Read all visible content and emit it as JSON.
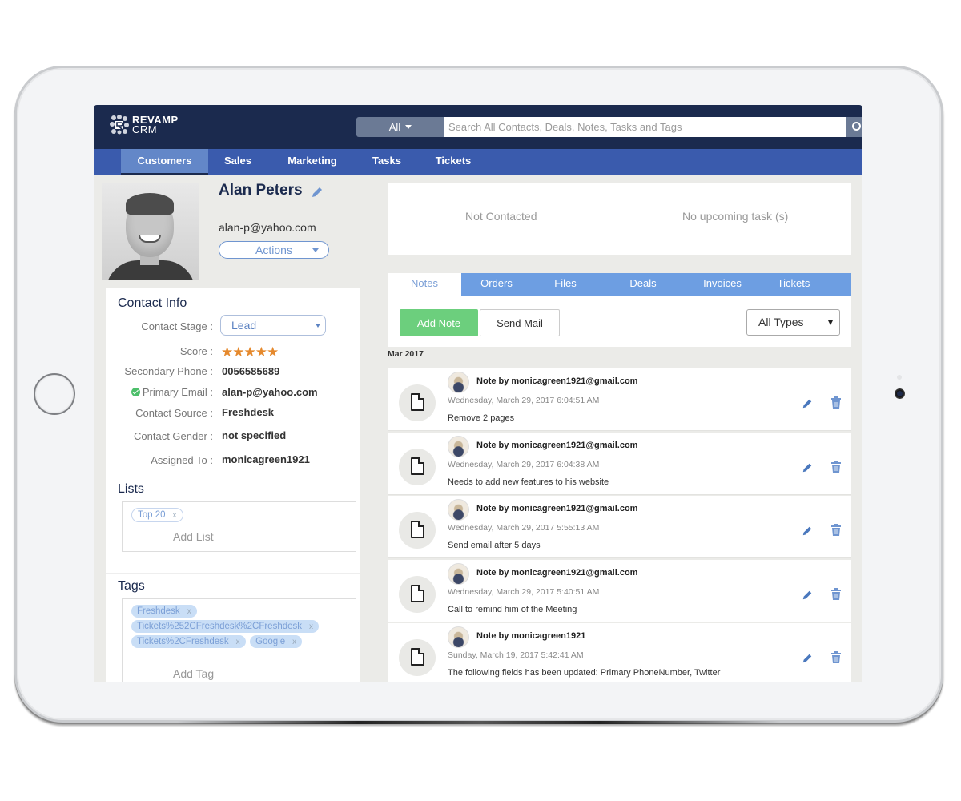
{
  "app": {
    "brand_line1": "REVAMP",
    "brand_line2": "CRM"
  },
  "search": {
    "scope": "All",
    "placeholder": "Search All Contacts, Deals, Notes, Tasks and Tags"
  },
  "nav": {
    "items": [
      {
        "label": "Customers",
        "active": true
      },
      {
        "label": "Sales"
      },
      {
        "label": "Marketing"
      },
      {
        "label": "Tasks"
      },
      {
        "label": "Tickets"
      }
    ]
  },
  "contact": {
    "name": "Alan Peters",
    "email": "alan-p@yahoo.com",
    "actions_label": "Actions"
  },
  "contact_info": {
    "title": "Contact Info",
    "stage_label": "Contact Stage :",
    "stage_value": "Lead",
    "score_label": "Score :",
    "score_stars": 5,
    "score_max": 5,
    "fields": [
      {
        "label": "Secondary Phone :",
        "value": "0056585689"
      },
      {
        "label": "Primary Email :",
        "value": "alan-p@yahoo.com",
        "verified": true
      },
      {
        "label": "Contact Source :",
        "value": "Freshdesk"
      },
      {
        "label": "Contact Gender :",
        "value": "not specified"
      },
      {
        "label": "Assigned To :",
        "value": "monicagreen1921"
      }
    ]
  },
  "lists": {
    "title": "Lists",
    "items": [
      "Top 20"
    ],
    "add_label": "Add List"
  },
  "tags": {
    "title": "Tags",
    "items": [
      "Freshdesk",
      "Tickets%252CFreshdesk%2CFreshdesk",
      "Tickets%2CFreshdesk",
      "Google"
    ],
    "add_label": "Add Tag"
  },
  "status": {
    "contact_status": "Not Contacted",
    "tasks_status": "No upcoming task (s)"
  },
  "tabs": {
    "items": [
      {
        "label": "Notes",
        "active": true
      },
      {
        "label": "Orders"
      },
      {
        "label": "Files"
      },
      {
        "label": "Deals"
      },
      {
        "label": "Invoices"
      },
      {
        "label": "Tickets"
      }
    ]
  },
  "toolbar": {
    "add_note_label": "Add Note",
    "send_mail_label": "Send Mail",
    "type_filter": "All Types"
  },
  "notes": {
    "month": "Mar 2017",
    "items": [
      {
        "author": "Note by monicagreen1921@gmail.com",
        "date": "Wednesday, March 29, 2017 6:04:51 AM",
        "text": "Remove 2 pages"
      },
      {
        "author": "Note by monicagreen1921@gmail.com",
        "date": "Wednesday, March 29, 2017 6:04:38 AM",
        "text": "Needs to add new features to his website"
      },
      {
        "author": "Note by monicagreen1921@gmail.com",
        "date": "Wednesday, March 29, 2017 5:55:13 AM",
        "text": "Send email after 5 days"
      },
      {
        "author": "Note by monicagreen1921@gmail.com",
        "date": "Wednesday, March 29, 2017 5:40:51 AM",
        "text": "Call to remind him of the Meeting"
      },
      {
        "author": "Note by monicagreen1921",
        "date": "Sunday, March 19, 2017 5:42:41 AM",
        "text": "The following fields has been updated: Primary PhoneNumber, Twitter Account, Secondary PhoneNumber, Contact Source, Tags, Groups, Score"
      }
    ]
  },
  "colors": {
    "topbar": "#1b2a4e",
    "navbar": "#3a5bad",
    "nav_active": "#6387c8",
    "tabs": "#6d9ee2",
    "add_note": "#6ccf7d",
    "stars": "#e5892d",
    "accent_blue": "#5b82c2"
  }
}
